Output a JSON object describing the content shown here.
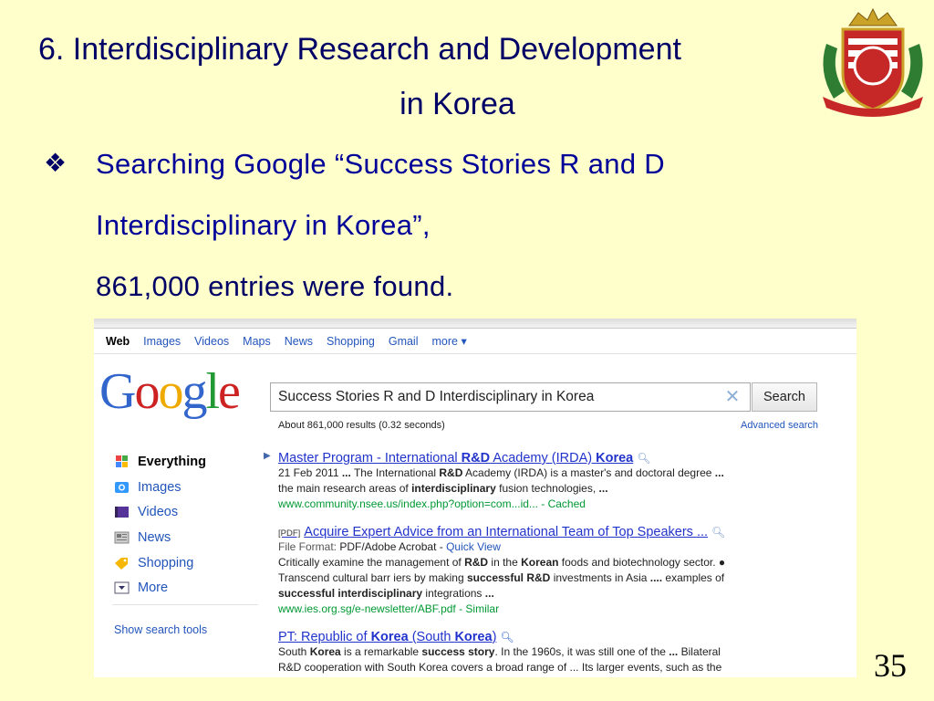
{
  "slide": {
    "title_line1": "6. Interdisciplinary Research and Development",
    "title_line2": "in Korea",
    "bullet_symbol": "❖",
    "bullet_line1": "Searching Google “Success Stories R and D",
    "bullet_line2": "Interdisciplinary in Korea”,",
    "bullet_line3": "861,000 entries were found.",
    "page_number": "35"
  },
  "google": {
    "nav": [
      "Web",
      "Images",
      "Videos",
      "Maps",
      "News",
      "Shopping",
      "Gmail",
      "more ▾"
    ],
    "logo": "Google",
    "query": "Success Stories R and D Interdisciplinary in Korea",
    "search_button": "Search",
    "stats": "About 861,000 results (0.32 seconds)",
    "advanced_search": "Advanced search",
    "sidebar": [
      {
        "label": "Everything",
        "icon": "everything-icon"
      },
      {
        "label": "Images",
        "icon": "images-icon"
      },
      {
        "label": "Videos",
        "icon": "videos-icon"
      },
      {
        "label": "News",
        "icon": "news-icon"
      },
      {
        "label": "Shopping",
        "icon": "shopping-icon"
      },
      {
        "label": "More",
        "icon": "more-icon"
      }
    ],
    "show_tools": "Show search tools",
    "results": [
      {
        "title_pre": "Master Program - International ",
        "title_b1": "R&D",
        "title_mid": " Academy (IRDA) ",
        "title_b2": "Korea",
        "snippet1_pre": "21 Feb 2011 ",
        "snippet1_b": "...",
        "snippet1_mid": " The International ",
        "snippet1_b2": "R&D",
        "snippet1_post": " Academy (IRDA) is a master's and doctoral degree ",
        "snippet1_b3": "...",
        "snippet2_pre": "the main research areas of ",
        "snippet2_b": "interdisciplinary",
        "snippet2_post": " fusion technologies, ",
        "snippet2_b2": "...",
        "url": "www.community.nsee.us/index.php?option=com...id... - Cached"
      },
      {
        "tag": "[PDF]",
        "title": "Acquire Expert Advice from an International Team of Top Speakers ...",
        "file_format_label": "File Format: ",
        "file_format": "PDF/Adobe Acrobat - ",
        "quick_view": "Quick View",
        "l1_pre": "Critically examine the management of ",
        "l1_b": "R&D",
        "l1_mid": " in the ",
        "l1_b2": "Korean",
        "l1_post": " foods and biotechnology sector. ●",
        "l2_pre": "Transcend cultural barr iers by making ",
        "l2_b": "successful R&D",
        "l2_post": " investments in Asia ",
        "l2_b2": "....",
        "l2_end": " examples of",
        "l3_b": "successful interdisciplinary",
        "l3_post": " integrations ",
        "l3_b2": "...",
        "url": "www.ies.org.sg/e-newsletter/ABF.pdf - Similar"
      },
      {
        "title_pre": "PT: Republic of ",
        "title_b1": "Korea",
        "title_mid": " (South ",
        "title_b2": "Korea",
        "title_post": ")",
        "s1_pre": "South ",
        "s1_b": "Korea",
        "s1_mid": " is a remarkable ",
        "s1_b2": "success story",
        "s1_post": ". In the 1960s, it was still one of the ",
        "s1_b3": "...",
        "s1_end": " Bilateral",
        "s2": "R&D cooperation with South Korea covers a broad range of ... Its larger events, such as the"
      }
    ]
  }
}
